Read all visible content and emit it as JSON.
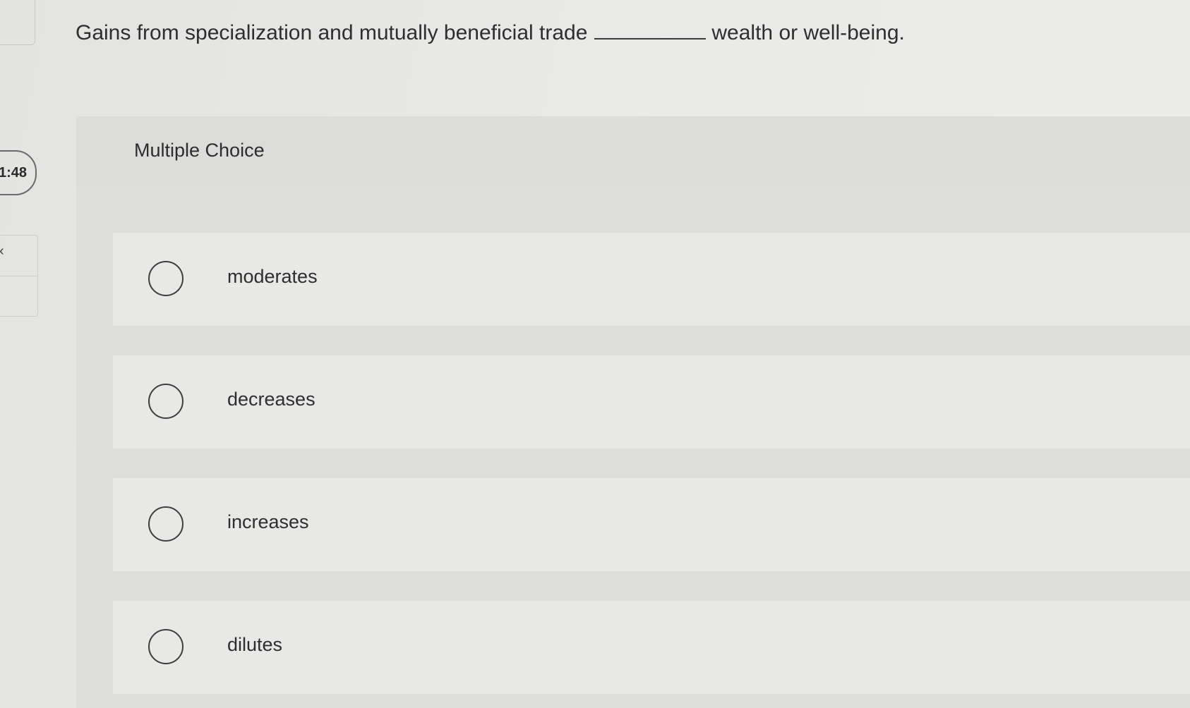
{
  "timer": {
    "text": "1:48"
  },
  "nav": {
    "prev_icon": "chevron-left-icon",
    "prev_glyph": "‹"
  },
  "question": {
    "text_before": "Gains from specialization and mutually beneficial trade",
    "text_after": "wealth or well-being."
  },
  "multiple_choice": {
    "title": "Multiple Choice",
    "options": [
      {
        "label": "moderates",
        "selected": false
      },
      {
        "label": "decreases",
        "selected": false
      },
      {
        "label": "increases",
        "selected": false
      },
      {
        "label": "dilutes",
        "selected": false
      }
    ]
  }
}
